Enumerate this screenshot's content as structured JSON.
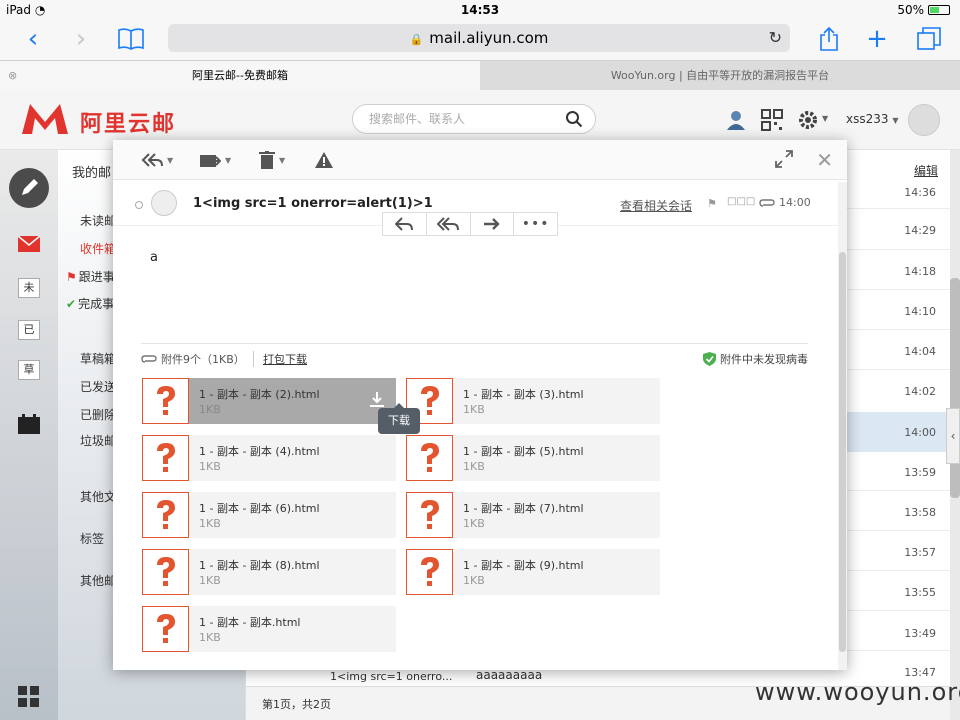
{
  "status_bar": {
    "device": "iPad",
    "time": "14:53",
    "battery": "50%"
  },
  "browser": {
    "url": "mail.aliyun.com",
    "tabs": [
      {
        "title": "阿里云邮--免费邮箱",
        "active": true
      },
      {
        "title": "WooYun.org | 自由平等开放的漏洞报告平台",
        "active": false
      }
    ]
  },
  "app": {
    "logo_text": "阿里云邮",
    "search_placeholder": "搜索邮件、联系人",
    "username": "xss233",
    "brand_color": "#e2342e"
  },
  "rail": {
    "items": [
      "未",
      "已",
      "草"
    ]
  },
  "folders": {
    "title": "我的邮",
    "items": [
      {
        "label": "未读邮",
        "color": "normal"
      },
      {
        "label": "收件箱",
        "color": "red"
      },
      {
        "label": "跟进事",
        "color": "normal"
      },
      {
        "label": "完成事",
        "color": "normal"
      },
      {
        "label": "草稿箱",
        "color": "normal"
      },
      {
        "label": "已发送",
        "color": "normal"
      },
      {
        "label": "已删除",
        "color": "normal"
      },
      {
        "label": "垃圾邮",
        "color": "normal"
      },
      {
        "label": "其他文",
        "color": "normal"
      },
      {
        "label": "标签",
        "color": "normal"
      },
      {
        "label": "其他邮",
        "color": "normal"
      }
    ]
  },
  "mail_list": {
    "edit_label": "编辑",
    "times": [
      "14:36",
      "14:29",
      "14:18",
      "14:10",
      "14:04",
      "14:02",
      "14:00",
      "13:59",
      "13:58",
      "13:57",
      "13:55",
      "13:49",
      "13:47"
    ],
    "last_row_subject": "1<img src=1 onerro...",
    "last_row_body": "aaaaaaaaa",
    "pager": "第1页，共2页"
  },
  "mail": {
    "subject": "1<img src=1 onerror=alert(1)>1",
    "related_label": "查看相关会话",
    "tags": "□□□",
    "time": "14:00",
    "body": "a",
    "attachment_summary": "附件9个（1KB）",
    "pack_download": "打包下载",
    "virus_status": "附件中未发现病毒",
    "tooltip": "下载",
    "attachments": [
      {
        "name": "1 - 副本 - 副本 (2).html",
        "size": "1KB",
        "hover": true
      },
      {
        "name": "1 - 副本 - 副本 (3).html",
        "size": "1KB"
      },
      {
        "name": "1 - 副本 - 副本 (4).html",
        "size": "1KB"
      },
      {
        "name": "1 - 副本 - 副本 (5).html",
        "size": "1KB"
      },
      {
        "name": "1 - 副本 - 副本 (6).html",
        "size": "1KB"
      },
      {
        "name": "1 - 副本 - 副本 (7).html",
        "size": "1KB"
      },
      {
        "name": "1 - 副本 - 副本 (8).html",
        "size": "1KB"
      },
      {
        "name": "1 - 副本 - 副本 (9).html",
        "size": "1KB"
      },
      {
        "name": "1 - 副本 - 副本.html",
        "size": "1KB"
      }
    ]
  },
  "watermark": "www.wooyun.org"
}
